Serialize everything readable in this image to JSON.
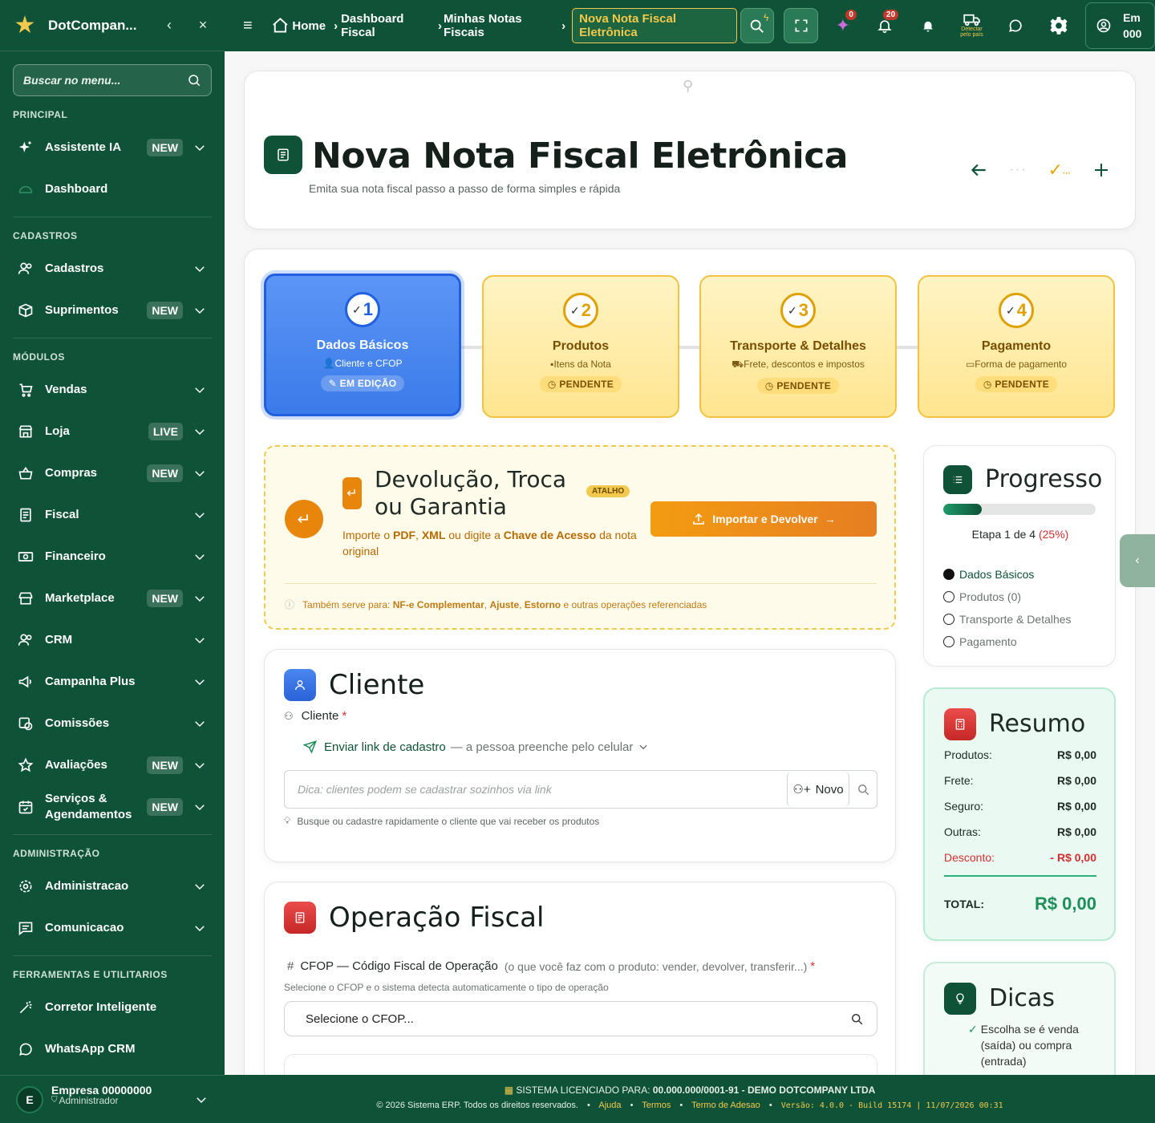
{
  "sidebar": {
    "brand": "DotCompan...",
    "search_placeholder": "Buscar no menu...",
    "sections": {
      "principal": "PRINCIPAL",
      "cadastros": "CADASTROS",
      "modulos": "MÓDULOS",
      "administracao": "ADMINISTRAÇÃO",
      "ferramentas": "FERRAMENTAS E UTILITARIOS"
    },
    "items": {
      "assistente": {
        "label": "Assistente IA",
        "badge": "NEW"
      },
      "dashboard": {
        "label": "Dashboard"
      },
      "cadastros": {
        "label": "Cadastros"
      },
      "suprimentos": {
        "label": "Suprimentos",
        "badge": "NEW"
      },
      "vendas": {
        "label": "Vendas"
      },
      "loja": {
        "label": "Loja",
        "badge": "LIVE"
      },
      "compras": {
        "label": "Compras",
        "badge": "NEW"
      },
      "fiscal": {
        "label": "Fiscal"
      },
      "financeiro": {
        "label": "Financeiro"
      },
      "marketplace": {
        "label": "Marketplace",
        "badge": "NEW"
      },
      "crm": {
        "label": "CRM"
      },
      "campanha": {
        "label": "Campanha Plus"
      },
      "comissoes": {
        "label": "Comissões"
      },
      "avaliacoes": {
        "label": "Avaliações",
        "badge": "NEW"
      },
      "servicos": {
        "label": "Serviços & Agendamentos",
        "badge": "NEW"
      },
      "administracao": {
        "label": "Administracao"
      },
      "comunicacao": {
        "label": "Comunicacao"
      },
      "corretor": {
        "label": "Corretor Inteligente"
      },
      "whatsapp": {
        "label": "WhatsApp CRM"
      }
    },
    "user": {
      "initial": "E",
      "name": "Empresa 00000000",
      "role": "Administrador"
    }
  },
  "topbar": {
    "breadcrumb": [
      "Home",
      "Dashboard Fiscal",
      "Minhas Notas Fiscais"
    ],
    "active_crumb": "Nova Nota Fiscal Eletrônica",
    "ai_badge": "0",
    "notif_badge": "20",
    "detect_label": "Detectar pelo país",
    "company_line1": "Em",
    "company_line2": "000"
  },
  "page": {
    "title": "Nova Nota Fiscal Eletrônica",
    "subtitle": "Emita sua nota fiscal passo a passo de forma simples e rápida"
  },
  "steps": [
    {
      "num": "1",
      "title": "Dados Básicos",
      "sub": "Cliente e CFOP",
      "status": "EM EDIÇÃO"
    },
    {
      "num": "2",
      "title": "Produtos",
      "sub": "Itens da Nota",
      "status": "PENDENTE"
    },
    {
      "num": "3",
      "title": "Transporte & Detalhes",
      "sub": "Frete, descontos e impostos",
      "status": "PENDENTE"
    },
    {
      "num": "4",
      "title": "Pagamento",
      "sub": "Forma de pagamento",
      "status": "PENDENTE"
    }
  ],
  "devolucao": {
    "title_line1": "Devolução, Troca",
    "title_line2": "ou Garantia",
    "tag": "ATALHO",
    "desc_pre": "Importe o ",
    "pdf": "PDF",
    "sep1": ", ",
    "xml": "XML",
    "mid": " ou digite a ",
    "chave": "Chave de Acesso",
    "desc_post": " da nota original",
    "button": "Importar e Devolver",
    "note_pre": "Também serve para: ",
    "note_nfe": "NF-e Complementar",
    "note_sep": ", ",
    "note_ajuste": "Ajuste",
    "note_estorno": "Estorno",
    "note_post": " e outras operações referenciadas"
  },
  "cliente": {
    "title": "Cliente",
    "label": "Cliente",
    "required": "*",
    "link_label": "Enviar link de cadastro",
    "link_desc": "— a pessoa preenche pelo celular",
    "placeholder": "Dica: clientes podem se cadastrar sozinhos via link",
    "novo": "Novo",
    "hint": "Busque ou cadastre rapidamente o cliente que vai receber os produtos"
  },
  "operacao": {
    "title": "Operação Fiscal",
    "label": "CFOP — Código Fiscal de Operação",
    "label_desc": "(o que você faz com o produto: vender, devolver, transferir...)",
    "required": "*",
    "help": "Selecione o CFOP e o sistema detecta automaticamente o tipo de operação",
    "placeholder": "Selecione o CFOP..."
  },
  "progresso": {
    "title": "Progresso",
    "percent": 25,
    "etapa": "Etapa 1 de 4",
    "pct_label": "(25%)",
    "items": [
      "Dados Básicos",
      "Produtos (0)",
      "Transporte & Detalhes",
      "Pagamento"
    ]
  },
  "resumo": {
    "title": "Resumo",
    "rows": [
      {
        "label": "Produtos:",
        "value": "R$ 0,00"
      },
      {
        "label": "Frete:",
        "value": "R$ 0,00"
      },
      {
        "label": "Seguro:",
        "value": "R$ 0,00"
      },
      {
        "label": "Outras:",
        "value": "R$ 0,00"
      }
    ],
    "desconto_label": "Desconto:",
    "desconto_value": "- R$ 0,00",
    "total_label": "TOTAL:",
    "total_value": "R$ 0,00"
  },
  "dicas": {
    "title": "Dicas",
    "tip1": "Escolha se é venda (saída) ou compra (entrada)"
  },
  "footer": {
    "lic_label": "SISTEMA LICENCIADO PARA:",
    "lic_value": "00.000.000/0001-91 - DEMO DOTCOMPANY LTDA",
    "copyright": "© 2026 Sistema ERP. Todos os direitos reservados.",
    "ajuda": "Ajuda",
    "termos": "Termos",
    "adesao": "Termo de Adesao",
    "version": "Versão: 4.0.0 - Build 15174 | 11/07/2026 00:31"
  },
  "colors": {
    "primary": "#0e5237",
    "accent": "#f2c94c",
    "orange": "#e67e22",
    "blue": "#3b7bea",
    "red": "#d32f2f",
    "green": "#1e8e5a"
  }
}
